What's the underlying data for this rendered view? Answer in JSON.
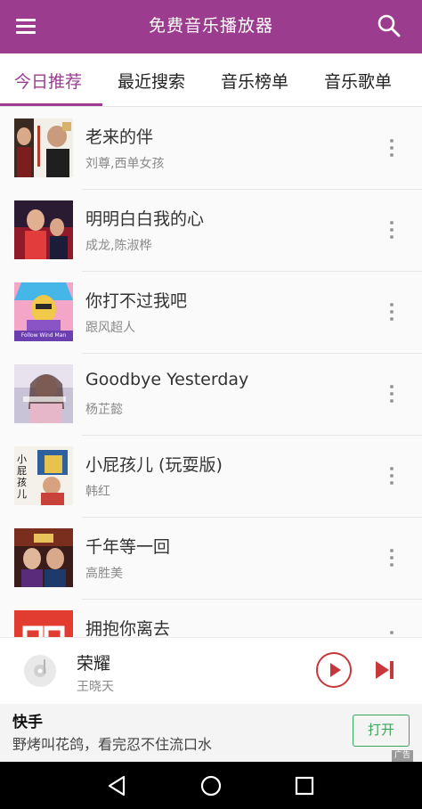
{
  "header": {
    "title": "免费音乐播放器",
    "menu_icon": "hamburger-menu-icon",
    "search_icon": "search-icon",
    "color": "#9b3c8f"
  },
  "tabs": [
    {
      "label": "今日推荐",
      "active": true
    },
    {
      "label": "最近搜索",
      "active": false
    },
    {
      "label": "音乐榜单",
      "active": false
    },
    {
      "label": "音乐歌单",
      "active": false
    }
  ],
  "songs": [
    {
      "title": "老来的伴",
      "artist": "刘尊,西单女孩"
    },
    {
      "title": "明明白白我的心",
      "artist": "成龙,陈淑桦"
    },
    {
      "title": "你打不过我吧",
      "artist": "跟风超人",
      "cover_text": "Follow Wind Man"
    },
    {
      "title": "Goodbye Yesterday",
      "artist": "杨芷懿"
    },
    {
      "title": "小屁孩儿 (玩耍版)",
      "artist": "韩红",
      "cover_text": "小屁孩儿"
    },
    {
      "title": "千年等一回",
      "artist": "高胜美"
    },
    {
      "title": "拥抱你离去",
      "artist": ""
    }
  ],
  "player": {
    "title": "荣耀",
    "artist": "王晓天",
    "play_icon": "play-icon",
    "next_icon": "skip-next-icon",
    "accent": "#c8383b"
  },
  "ad": {
    "title": "快手",
    "description": "野烤叫花鸽，看完忍不住流口水",
    "button": "打开",
    "label": "广告"
  },
  "navbar": {
    "back_icon": "back-triangle-icon",
    "home_icon": "home-circle-icon",
    "recents_icon": "recents-square-icon"
  }
}
